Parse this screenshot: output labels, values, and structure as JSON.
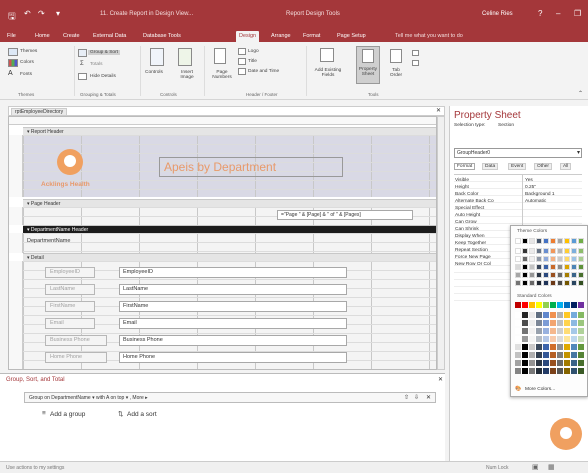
{
  "window": {
    "doc_title": "11. Create Report in Design View...",
    "context_title": "Report Design Tools",
    "user": "Celine Ries",
    "help": "?",
    "minimize": "–",
    "restore": "❐"
  },
  "tabs": [
    {
      "label": "File"
    },
    {
      "label": "Home"
    },
    {
      "label": "Create"
    },
    {
      "label": "External Data"
    },
    {
      "label": "Database Tools"
    },
    {
      "label": "Design"
    },
    {
      "label": "Arrange"
    },
    {
      "label": "Format"
    },
    {
      "label": "Page Setup"
    }
  ],
  "tellme": "Tell me what you want to do",
  "ribbon": {
    "themes": "Themes",
    "colors": "Colors",
    "fonts": "Fonts",
    "themes_group": "Themes",
    "group_sort": "Group & Sort",
    "totals": "Totals",
    "hide_details": "Hide Details",
    "grouping_group": "Grouping & Totals",
    "controls": "Controls",
    "insert_image": "Insert Image",
    "controls_group": "Controls",
    "page_numbers": "Page Numbers",
    "logo": "Logo",
    "title": "Title",
    "date_time": "Date and Time",
    "header_group": "Header / Footer",
    "add_fields": "Add Existing Fields",
    "property_sheet": "Property Sheet",
    "tab_order": "Tab Order",
    "tools_group": "Tools"
  },
  "document": {
    "tab": "rptEmployeeDirectory",
    "report_header": "Report Header",
    "logo_text": "Acklings Health",
    "report_title": "Apeis by Department",
    "page_header": "Page Header",
    "page_expression": "=\"Page \" & [Page] & \" of \" & [Pages]",
    "department_header": "DepartmentName Header",
    "department_label": "DepartmentName",
    "detail": "Detail",
    "rows": [
      {
        "label": "EmployeeID",
        "field": "EmployeeID"
      },
      {
        "label": "LastName",
        "field": "LastName"
      },
      {
        "label": "FirstName",
        "field": "FirstName"
      },
      {
        "label": "Email",
        "field": "Email"
      },
      {
        "label": "Business Phone",
        "field": "Business Phone"
      },
      {
        "label": "Home Phone",
        "field": "Home Phone"
      }
    ]
  },
  "group_sort": {
    "title": "Group, Sort, and Total",
    "group_row": "Group on DepartmentName ▾  with A on top ▾ , More ▸",
    "add_group": "Add a group",
    "add_sort": "Add a sort"
  },
  "property_sheet": {
    "title": "Property Sheet",
    "selection_type_label": "Selection type:",
    "selection_type": "Section",
    "selected": "GroupHeader0",
    "tabs": [
      "Format",
      "Data",
      "Event",
      "Other",
      "All"
    ],
    "props": [
      {
        "label": "Visible",
        "value": "Yes"
      },
      {
        "label": "Height",
        "value": "0.25\""
      },
      {
        "label": "Back Color",
        "value": "Background 1"
      },
      {
        "label": "Alternate Back Co",
        "value": "Automatic"
      },
      {
        "label": "Special Effect",
        "value": ""
      },
      {
        "label": "Auto Height",
        "value": ""
      },
      {
        "label": "Can Grow",
        "value": ""
      },
      {
        "label": "Can Shrink",
        "value": ""
      },
      {
        "label": "Display When",
        "value": ""
      },
      {
        "label": "Keep Together",
        "value": ""
      },
      {
        "label": "Repeat Section",
        "value": ""
      },
      {
        "label": "Force New Page",
        "value": ""
      },
      {
        "label": "New Row Or Col",
        "value": ""
      }
    ]
  },
  "palette": {
    "theme_colors": "Theme Colors",
    "standard_colors": "Standard Colors",
    "more_colors": "More Colors...",
    "theme_cols": [
      "#ffffff",
      "#000000",
      "#e7e6e6",
      "#44546a",
      "#4472c4",
      "#ed7d31",
      "#a5a5a5",
      "#ffc000",
      "#5b9bd5",
      "#70ad47"
    ],
    "standard": [
      "#c00000",
      "#ff0000",
      "#ffc000",
      "#ffff00",
      "#92d050",
      "#00b050",
      "#00b0f0",
      "#0070c0",
      "#002060",
      "#7030a0"
    ]
  },
  "statusbar": {
    "left": "Use actions to my settings",
    "right": "Num Lock"
  },
  "colors": {
    "accent": "#a4373a",
    "logo_orange": "#f0a060",
    "title_text": "#e89a6a"
  }
}
